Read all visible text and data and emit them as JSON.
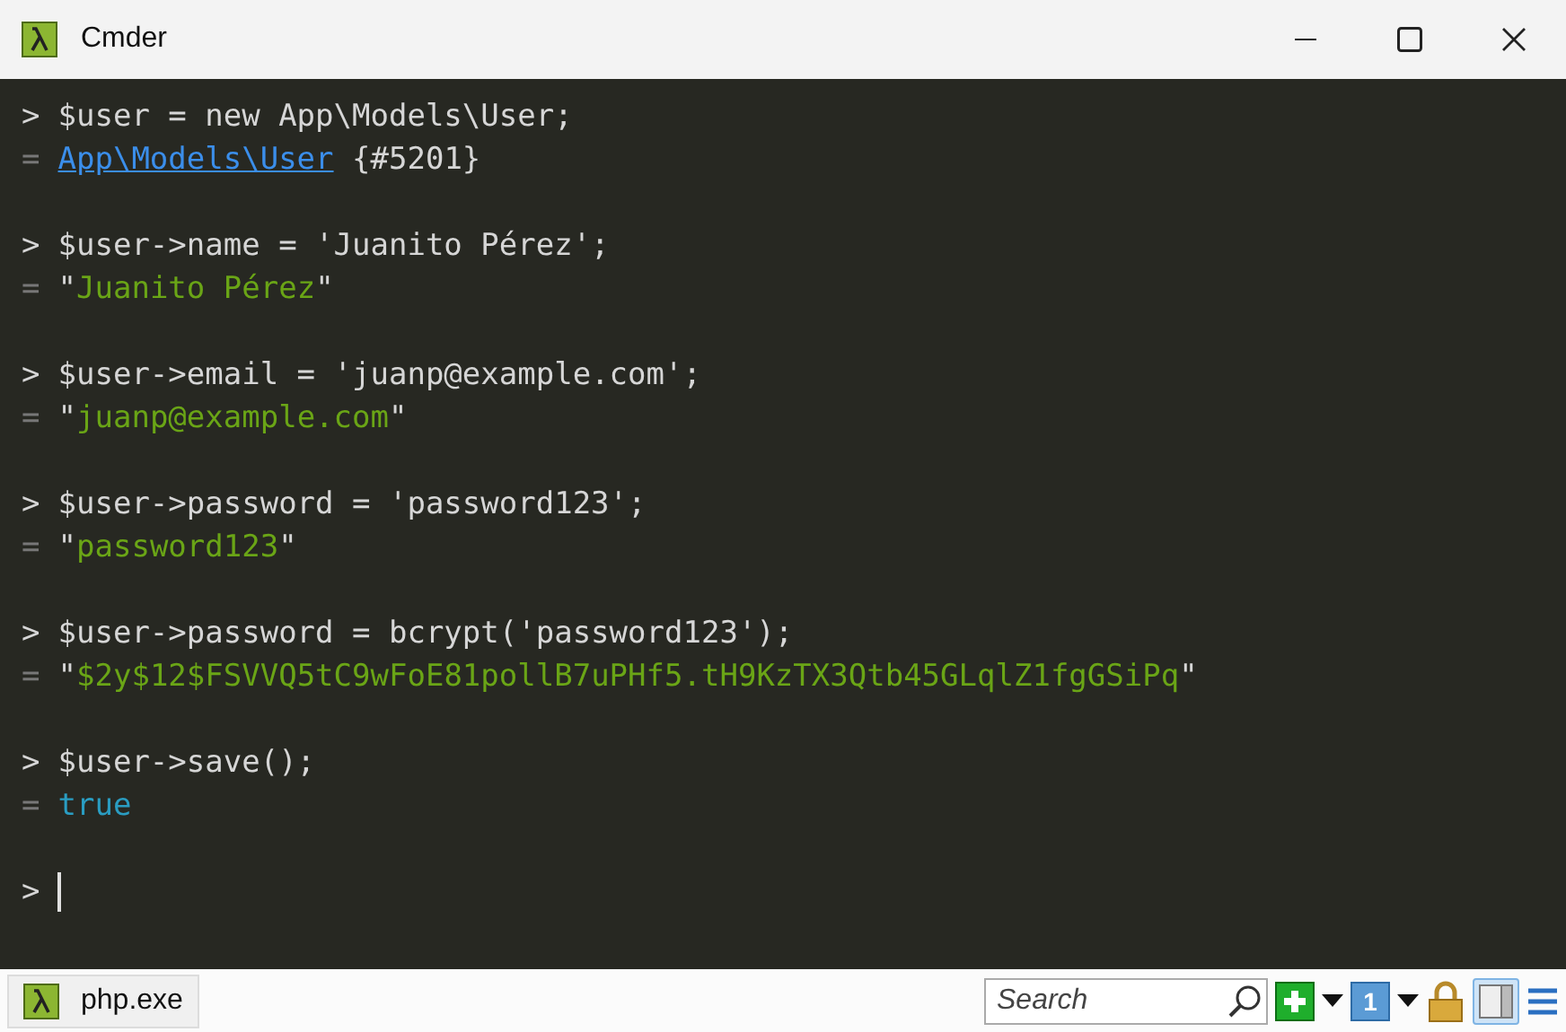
{
  "window": {
    "title": "Cmder"
  },
  "terminal": {
    "entries": [
      {
        "input": {
          "prompt": ">",
          "text": "$user = new App\\Models\\User;"
        },
        "output": {
          "prompt": "=",
          "parts": [
            {
              "kind": "link",
              "text": "App\\Models\\User"
            },
            {
              "kind": "plain",
              "text": " {#5201}"
            }
          ]
        }
      },
      {
        "input": {
          "prompt": ">",
          "text": "$user->name = 'Juanito Pérez';"
        },
        "output": {
          "prompt": "=",
          "parts": [
            {
              "kind": "plain",
              "text": "\""
            },
            {
              "kind": "string",
              "text": "Juanito Pérez"
            },
            {
              "kind": "plain",
              "text": "\""
            }
          ]
        }
      },
      {
        "input": {
          "prompt": ">",
          "text": "$user->email = 'juanp@example.com';"
        },
        "output": {
          "prompt": "=",
          "parts": [
            {
              "kind": "plain",
              "text": "\""
            },
            {
              "kind": "string",
              "text": "juanp@example.com"
            },
            {
              "kind": "plain",
              "text": "\""
            }
          ]
        }
      },
      {
        "input": {
          "prompt": ">",
          "text": "$user->password = 'password123';"
        },
        "output": {
          "prompt": "=",
          "parts": [
            {
              "kind": "plain",
              "text": "\""
            },
            {
              "kind": "string",
              "text": "password123"
            },
            {
              "kind": "plain",
              "text": "\""
            }
          ]
        }
      },
      {
        "input": {
          "prompt": ">",
          "text": "$user->password = bcrypt('password123');"
        },
        "output": {
          "prompt": "=",
          "parts": [
            {
              "kind": "plain",
              "text": "\""
            },
            {
              "kind": "string",
              "text": "$2y$12$FSVVQ5tC9wFoE81pollB7uPHf5.tH9KzTX3Qtb45GLqlZ1fgGSiPq"
            },
            {
              "kind": "plain",
              "text": "\""
            }
          ]
        }
      },
      {
        "input": {
          "prompt": ">",
          "text": "$user->save();"
        },
        "output": {
          "prompt": "=",
          "parts": [
            {
              "kind": "keyword",
              "text": "true"
            }
          ]
        }
      }
    ],
    "current_prompt": ">"
  },
  "status_bar": {
    "tab": {
      "label": "php.exe"
    },
    "search": {
      "placeholder": "Search"
    },
    "console_number": "1",
    "split_view": {
      "selected": true
    }
  }
}
